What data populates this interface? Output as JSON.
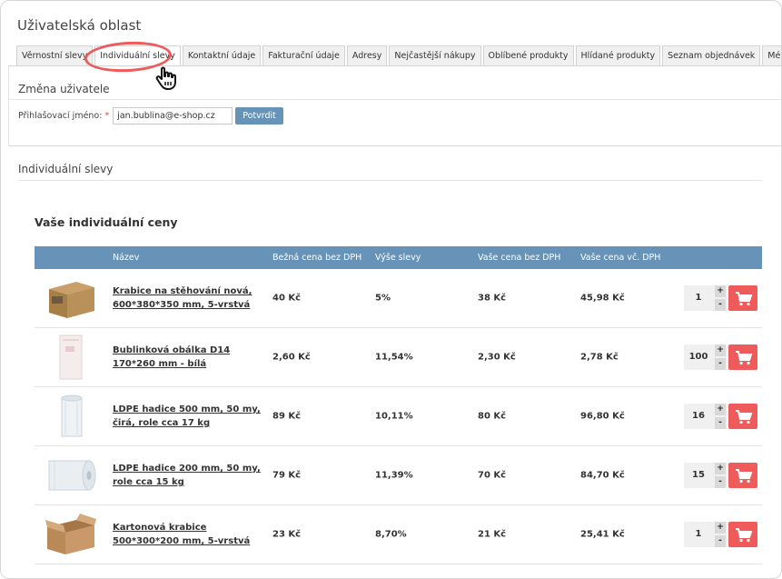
{
  "page": {
    "title": "Uživatelská oblast"
  },
  "tabs": [
    {
      "label": "Věrnostní slevy"
    },
    {
      "label": "Individuální slevy"
    },
    {
      "label": "Kontaktní údaje"
    },
    {
      "label": "Fakturační údaje"
    },
    {
      "label": "Adresy"
    },
    {
      "label": "Nejčastější nákupy"
    },
    {
      "label": "Oblíbené produkty"
    },
    {
      "label": "Hlídané produkty"
    },
    {
      "label": "Seznam objednávek"
    },
    {
      "label": "Mé doklady"
    }
  ],
  "active_tab": "Individuální slevy",
  "change_user": {
    "title": "Změna uživatele",
    "login_label": "Přihlašovací jméno:",
    "required_mark": "*",
    "login_value": "jan.bublina@e-shop.cz",
    "confirm_label": "Potvrdit"
  },
  "discounts_section": {
    "title": "Individuální slevy"
  },
  "prices": {
    "title": "Vaše individuální ceny",
    "columns": [
      "Název",
      "Bežná cena bez DPH",
      "Výše slevy",
      "Vaše cena bez DPH",
      "Vaše cena vč. DPH"
    ],
    "rows": [
      {
        "name": "Krabice na stěhování nová, 600*380*350 mm, 5-vrstvá",
        "regular_price": "40 Kč",
        "discount": "5%",
        "your_price": "38 Kč",
        "your_price_vat": "45,98 Kč",
        "quantity": "1",
        "image": "cardboard-box"
      },
      {
        "name": "Bublinková obálka D14 170*260 mm - bílá",
        "regular_price": "2,60 Kč",
        "discount": "11,54%",
        "your_price": "2,30 Kč",
        "your_price_vat": "2,78 Kč",
        "quantity": "100",
        "image": "bubble-envelope"
      },
      {
        "name": "LDPE hadice 500 mm, 50 my, čirá, role cca 17 kg",
        "regular_price": "89 Kč",
        "discount": "10,11%",
        "your_price": "80 Kč",
        "your_price_vat": "96,80 Kč",
        "quantity": "16",
        "image": "tall-roll"
      },
      {
        "name": "LDPE hadice 200 mm, 50 my, role cca 15 kg",
        "regular_price": "79 Kč",
        "discount": "11,39%",
        "your_price": "70 Kč",
        "your_price_vat": "84,70 Kč",
        "quantity": "15",
        "image": "wide-roll"
      },
      {
        "name": "Kartonová krabice 500*300*200 mm, 5-vrstvá",
        "regular_price": "23 Kč",
        "discount": "8,70%",
        "your_price": "21 Kč",
        "your_price_vat": "25,41 Kč",
        "quantity": "1",
        "image": "open-box"
      }
    ]
  },
  "controls": {
    "plus": "+",
    "minus": "-",
    "cart_icon": "shopping-cart-icon"
  },
  "colors": {
    "accent_blue": "#6793b8",
    "cart_red": "#ef5a5a",
    "highlight_red": "#ef5a5a"
  }
}
